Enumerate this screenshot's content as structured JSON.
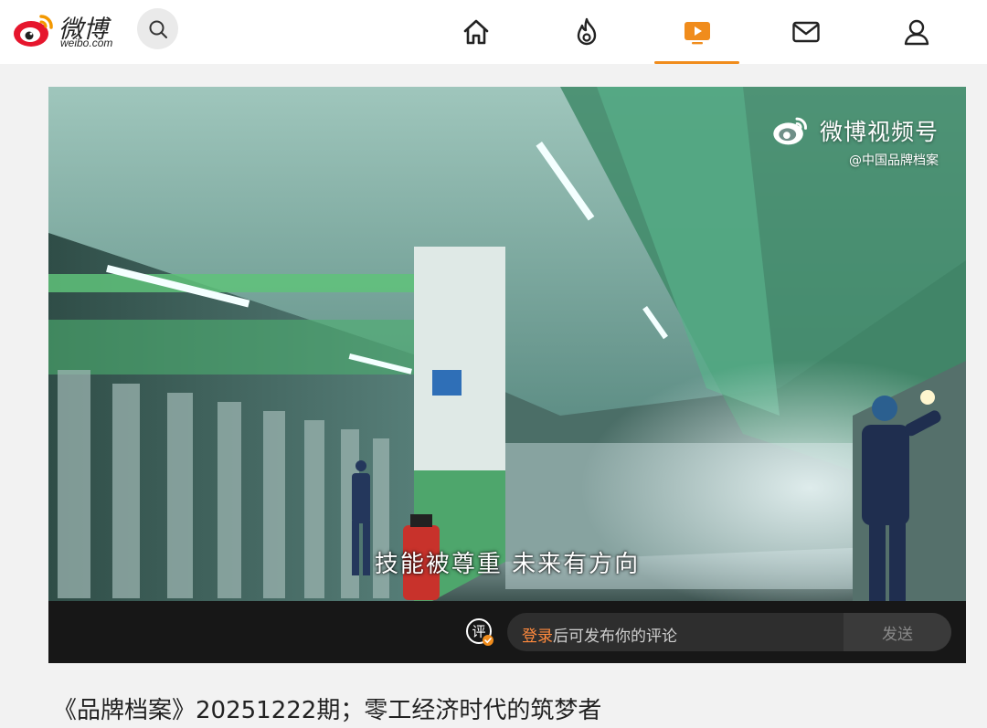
{
  "app": {
    "logo_cn": "微博",
    "logo_en": "weibo.com"
  },
  "nav": {
    "items": [
      {
        "icon": "home-icon",
        "active": false
      },
      {
        "icon": "hot-fire-icon",
        "active": false
      },
      {
        "icon": "video-play-icon",
        "active": true
      },
      {
        "icon": "mail-icon",
        "active": false
      },
      {
        "icon": "user-icon",
        "active": false
      }
    ],
    "accent_color": "#f08c1c"
  },
  "video": {
    "watermark_title": "微博视频号",
    "watermark_account": "@中国品牌档案",
    "subtitle": "技能被尊重  未来有方向",
    "sign_text": ""
  },
  "comment": {
    "login_label": "登录",
    "placeholder_rest": "后可发布你的评论",
    "send_label": "发送",
    "icon_char": "评"
  },
  "post": {
    "title": "《品牌档案》20251222期；零工经济时代的筑梦者"
  }
}
